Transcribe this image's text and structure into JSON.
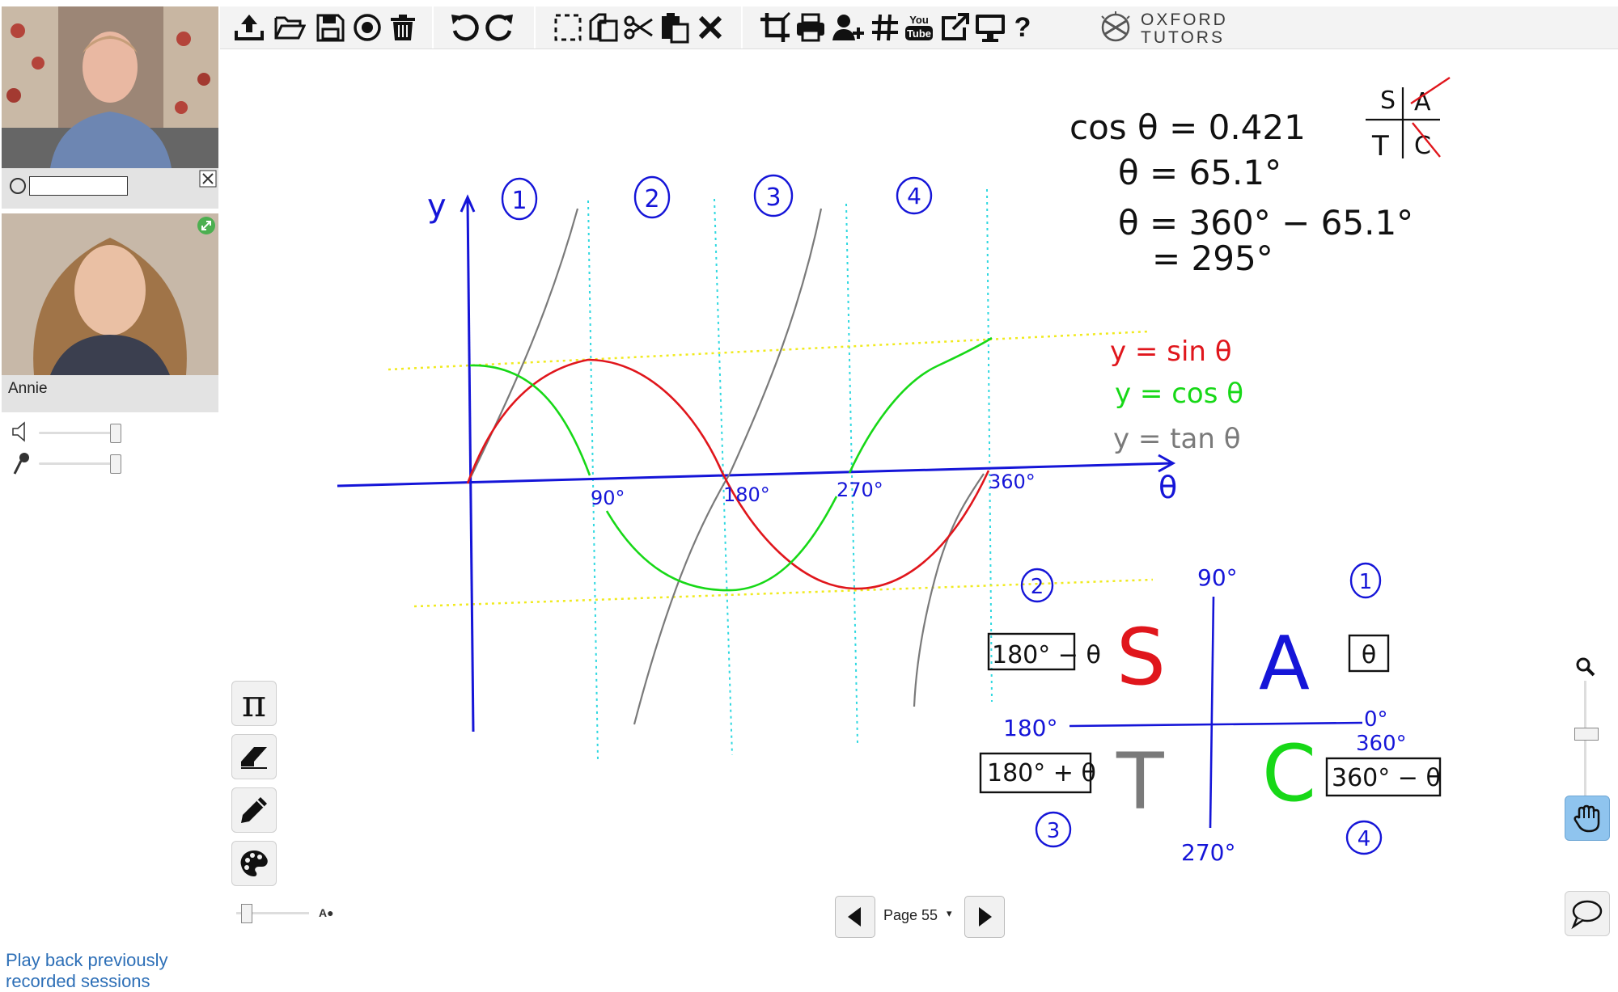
{
  "participants": {
    "teacher": {
      "name_value": ""
    },
    "student": {
      "name": "Annie"
    }
  },
  "toolbar": {
    "logo_line1": "OXFORD",
    "logo_line2": "TUTORS",
    "youtube_label_top": "You",
    "youtube_label_bottom": "Tube",
    "help_label": "?"
  },
  "pager": {
    "page_label": "Page 55",
    "caret": "▾"
  },
  "side_tools": {
    "pi": "π",
    "pen_size_label": "A●"
  },
  "playback_link": "Play back previously recorded sessions",
  "whiteboard": {
    "axis_y": "y",
    "axis_theta": "θ",
    "quadrant_numbers": [
      "1",
      "2",
      "3",
      "4"
    ],
    "x_ticks": [
      "90°",
      "180°",
      "270°",
      "360°"
    ],
    "legend": {
      "sin": "y = sin θ",
      "cos": "y = cos θ",
      "tan": "y = tan θ"
    },
    "working": {
      "line1": "cos θ = 0.421",
      "line2": "θ = 65.1°",
      "line3": "θ = 360° − 65.1°",
      "line4": "= 295°"
    },
    "mini_cast": {
      "s": "S",
      "a": "A",
      "t": "T",
      "c": "C"
    },
    "cast": {
      "top": "90°",
      "left": "180°",
      "right_top": "0°",
      "right_bottom": "360°",
      "bottom": "270°",
      "letter_s": "S",
      "letter_a": "A",
      "letter_t": "T",
      "letter_c": "C",
      "box_q1": "θ",
      "box_q2": "180° − θ",
      "box_q3": "180° + θ",
      "box_q4": "360° − θ",
      "q1": "1",
      "q2": "2",
      "q3": "3",
      "q4": "4"
    }
  },
  "colors": {
    "blue": "#1515d8",
    "red": "#e0161c",
    "green": "#17d817",
    "gray": "#7a7a7a",
    "cyan": "#2fd8e0",
    "yellow": "#f0ea1e"
  }
}
